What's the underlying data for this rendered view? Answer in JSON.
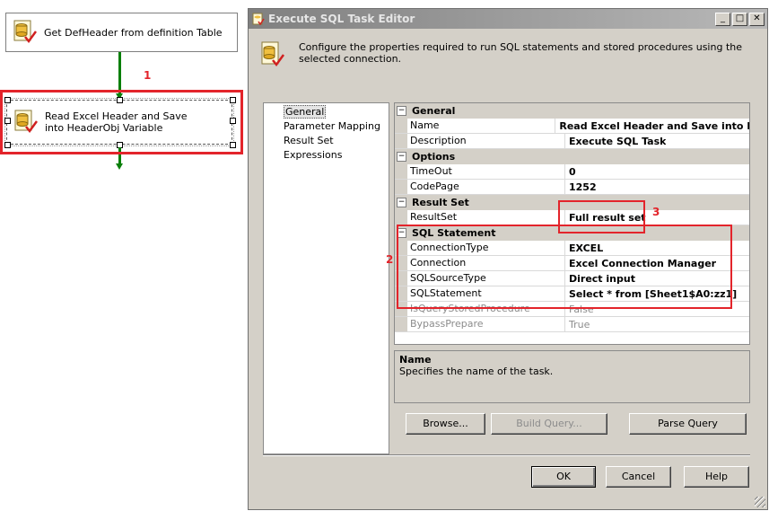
{
  "design_surface": {
    "task_top_label": "Get DefHeader from definition Table",
    "task_selected_label": "Read Excel Header and Save into HeaderObj Variable"
  },
  "annotations": {
    "n1": "1",
    "n2": "2",
    "n3": "3"
  },
  "dialog": {
    "title": "Execute SQL Task Editor",
    "window_buttons": {
      "minimize": "_",
      "maximize": "□",
      "close": "✕"
    },
    "description": "Configure the properties required to run SQL statements and stored procedures using the selected connection.",
    "nav": [
      "General",
      "Parameter Mapping",
      "Result Set",
      "Expressions"
    ],
    "nav_selected": "General",
    "grid": {
      "cat_general": "General",
      "name_label": "Name",
      "name_value": "Read Excel Header and Save into He",
      "desc_label": "Description",
      "desc_value": "Execute SQL Task",
      "cat_options": "Options",
      "timeout_label": "TimeOut",
      "timeout_value": "0",
      "codepage_label": "CodePage",
      "codepage_value": "1252",
      "cat_resultset": "Result Set",
      "resultset_label": "ResultSet",
      "resultset_value": "Full result set",
      "cat_sql": "SQL Statement",
      "conntype_label": "ConnectionType",
      "conntype_value": "EXCEL",
      "connection_label": "Connection",
      "connection_value": "Excel Connection Manager",
      "sqlsourcetype_label": "SQLSourceType",
      "sqlsourcetype_value": "Direct input",
      "sqlstatement_label": "SQLStatement",
      "sqlstatement_value": "Select * from [Sheet1$A0:zz1]",
      "isqsp_label": "IsQueryStoredProcedure",
      "isqsp_value": "False",
      "bypass_label": "BypassPrepare",
      "bypass_value": "True"
    },
    "help_title": "Name",
    "help_text": "Specifies the name of the task.",
    "buttons": {
      "browse": "Browse...",
      "build_query": "Build Query...",
      "parse_query": "Parse Query",
      "ok": "OK",
      "cancel": "Cancel",
      "help": "Help"
    }
  },
  "colors": {
    "annotation_red": "#e3242b",
    "connector_green": "#0a7f0a",
    "dialog_face": "#d4d0c8"
  }
}
